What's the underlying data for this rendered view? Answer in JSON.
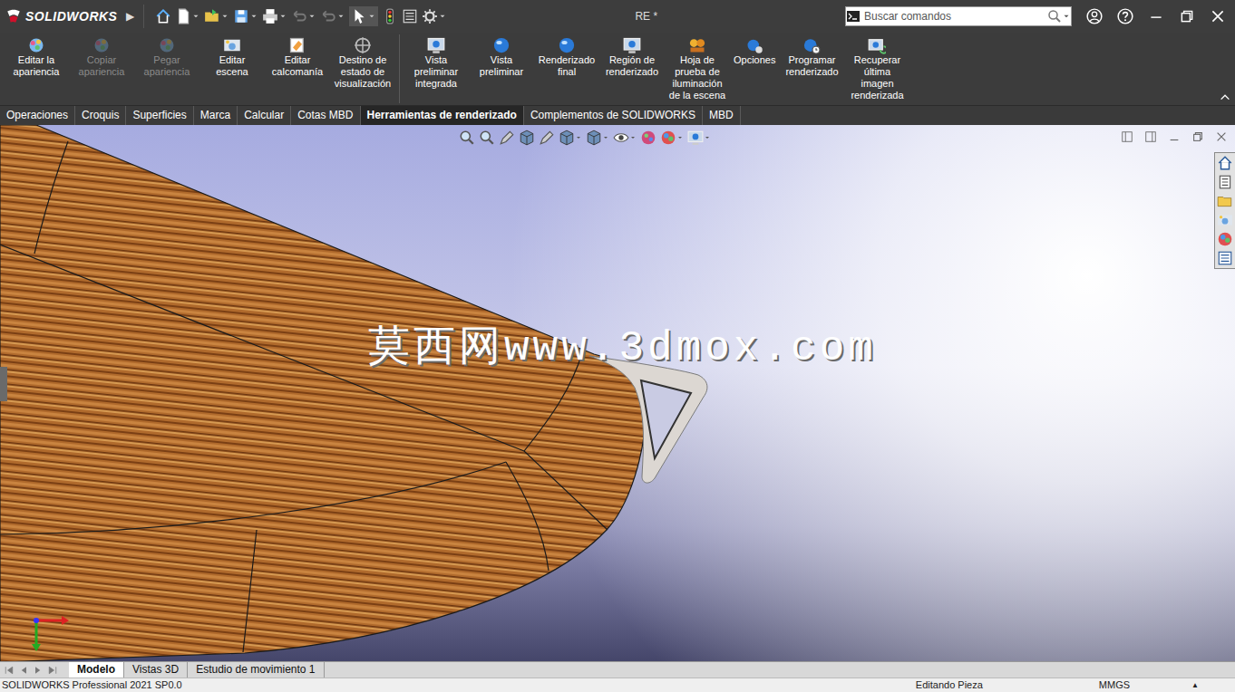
{
  "window": {
    "app": "SOLIDWORKS",
    "menu_arrow": "▶",
    "title": "RE *"
  },
  "search": {
    "placeholder": "Buscar comandos"
  },
  "ribbon": {
    "commands": [
      {
        "label": "Editar la apariencia",
        "disabled": false
      },
      {
        "label": "Copiar apariencia",
        "disabled": true
      },
      {
        "label": "Pegar apariencia",
        "disabled": true
      },
      {
        "label": "Editar escena",
        "disabled": false
      },
      {
        "label": "Editar calcomanía",
        "disabled": false
      },
      {
        "label": "Destino de estado de visualización",
        "disabled": false
      },
      {
        "label": "Vista preliminar integrada",
        "disabled": false
      },
      {
        "label": "Vista preliminar",
        "disabled": false
      },
      {
        "label": "Renderizado final",
        "disabled": false
      },
      {
        "label": "Región de renderizado",
        "disabled": false
      },
      {
        "label": "Hoja de prueba de iluminación de la escena",
        "disabled": false
      },
      {
        "label": "Opciones",
        "disabled": false
      },
      {
        "label": "Programar renderizado",
        "disabled": false
      },
      {
        "label": "Recuperar última imagen renderizada",
        "disabled": false
      }
    ]
  },
  "tabs": [
    {
      "label": "Operaciones",
      "selected": false
    },
    {
      "label": "Croquis",
      "selected": false
    },
    {
      "label": "Superficies",
      "selected": false
    },
    {
      "label": "Marca",
      "selected": false
    },
    {
      "label": "Calcular",
      "selected": false
    },
    {
      "label": "Cotas MBD",
      "selected": false
    },
    {
      "label": "Herramientas de renderizado",
      "selected": true
    },
    {
      "label": "Complementos de SOLIDWORKS",
      "selected": false
    },
    {
      "label": "MBD",
      "selected": false
    }
  ],
  "viewport": {
    "watermark": "莫西网www.3dmox.com"
  },
  "bottom_tabs": [
    {
      "label": "Modelo",
      "selected": true
    },
    {
      "label": "Vistas 3D",
      "selected": false
    },
    {
      "label": "Estudio de movimiento 1",
      "selected": false
    }
  ],
  "status_bar": {
    "product": "SOLIDWORKS Professional 2021 SP0.0",
    "mode": "Editando Pieza",
    "units": "MMGS",
    "units_arrow": "▲"
  }
}
